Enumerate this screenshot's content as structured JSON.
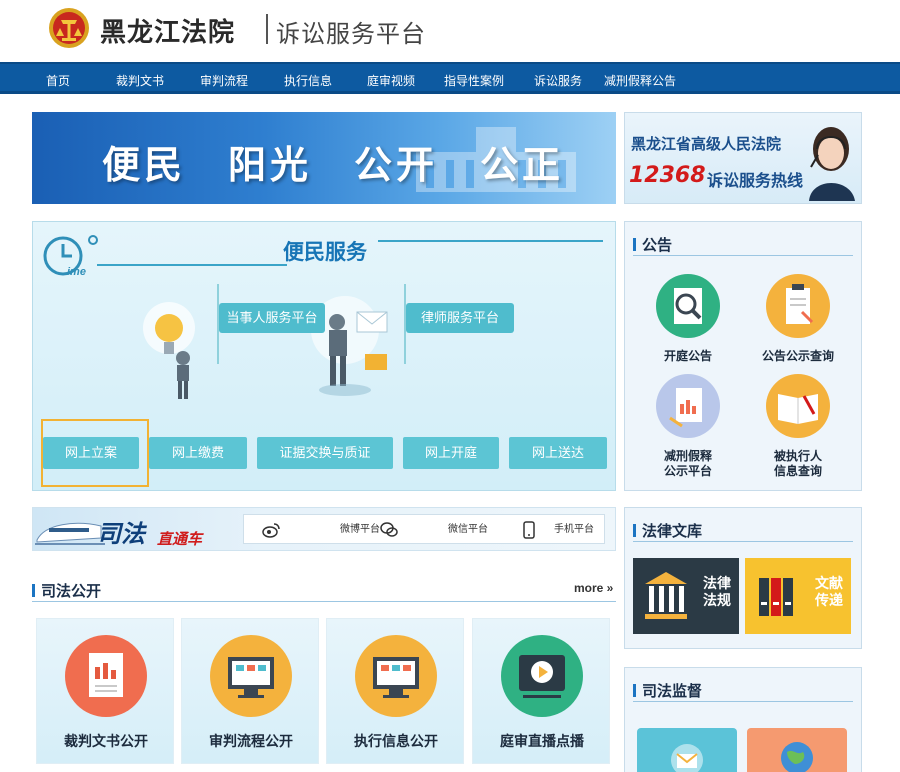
{
  "header": {
    "site_name": "黑龙江法院",
    "site_sub": "诉讼服务平台"
  },
  "nav": {
    "items": [
      "首页",
      "裁判文书",
      "审判流程",
      "执行信息",
      "庭审视频",
      "指导性案例",
      "诉讼服务",
      "减刑假释公告"
    ]
  },
  "banner": {
    "slogan": "便民　阳光　公开　公正"
  },
  "hotline": {
    "court": "黑龙江省高级人民法院",
    "number": "12368",
    "label": "诉讼服务热线"
  },
  "service": {
    "title": "便民服务",
    "clock_word": "ime",
    "party_platform": "当事人服务平台",
    "lawyer_platform": "律师服务平台",
    "buttons": [
      "网上立案",
      "网上缴费",
      "证据交换与质证",
      "网上开庭",
      "网上送达"
    ]
  },
  "strip": {
    "title": "司法",
    "subtitle": "直通车",
    "items": [
      "微博平台",
      "微信平台",
      "手机平台"
    ]
  },
  "judicial_open": {
    "title": "司法公开",
    "more": "more »",
    "cards": [
      "裁判文书公开",
      "审判流程公开",
      "执行信息公开",
      "庭审直播点播"
    ]
  },
  "notice": {
    "title": "公告",
    "items": [
      "开庭公告",
      "公告公示查询",
      "减刑假释\n公示平台",
      "被执行人\n信息查询"
    ]
  },
  "law_library": {
    "title": "法律文库",
    "tiles": [
      "法律\n法规",
      "文献\n传递"
    ]
  },
  "supervision": {
    "title": "司法监督"
  },
  "colors": {
    "nav_bg": "#0d5aa1",
    "accent": "#1775b6",
    "button": "#5cc5d4",
    "highlight": "#f2b233",
    "hotline_red": "#d31a1a"
  }
}
